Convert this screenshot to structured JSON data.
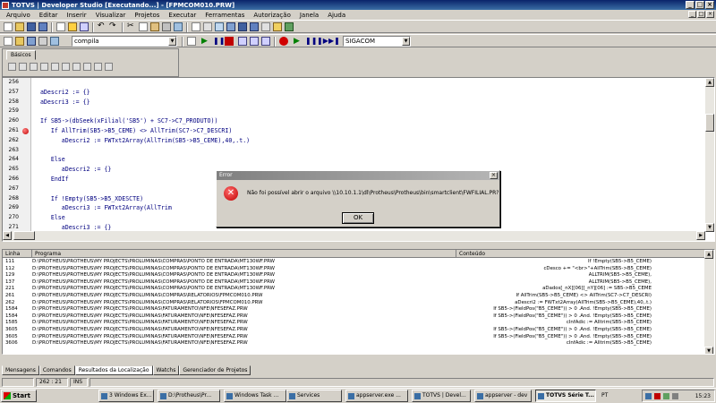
{
  "window": {
    "title": "TOTVS | Developer Studio [Executando...] - [FPMCOM010.PRW]"
  },
  "menu": [
    "Arquivo",
    "Editar",
    "Inserir",
    "Visualizar",
    "Projetos",
    "Executar",
    "Ferramentas",
    "Autorização",
    "Janela",
    "Ajuda"
  ],
  "toolbar": {
    "compile_combo": "compila",
    "environment_combo": "SIGACOM"
  },
  "palette": {
    "tab_label": "Básicos"
  },
  "editor": {
    "lines": [
      {
        "num": "256",
        "code": ""
      },
      {
        "num": "257",
        "code": "  aDescri2 := {}"
      },
      {
        "num": "258",
        "code": "  aDescri3 := {}"
      },
      {
        "num": "259",
        "code": ""
      },
      {
        "num": "260",
        "code": "  If SB5->(dbSeek(xFilial('SB5') + SC7->C7_PRODUTO))"
      },
      {
        "num": "261",
        "code": "     If AllTrim(SB5->B5_CEME) <> AllTrim(SC7->C7_DESCRI)",
        "breakpoint": true
      },
      {
        "num": "262",
        "code": "        aDescri2 := FWTxt2Array(AllTrim(SB5->B5_CEME),40,.t.)"
      },
      {
        "num": "263",
        "code": ""
      },
      {
        "num": "264",
        "code": "     Else"
      },
      {
        "num": "265",
        "code": "        aDescri2 := {}"
      },
      {
        "num": "266",
        "code": "     EndIf"
      },
      {
        "num": "267",
        "code": ""
      },
      {
        "num": "268",
        "code": "     If !Empty(SB5->B5_XDESCTE)"
      },
      {
        "num": "269",
        "code": "        aDescri3 := FWTxt2Array(AllTrim"
      },
      {
        "num": "270",
        "code": "     Else"
      },
      {
        "num": "271",
        "code": "        aDescri3 := {}"
      },
      {
        "num": "272",
        "code": "     EndIf"
      },
      {
        "num": "273",
        "code": ""
      }
    ]
  },
  "dialog": {
    "title": "Error",
    "message": "Não foi possível abrir o arquivo \\\\10.10.1.1\\dl\\Protheus\\Protheus\\bin\\smartclient\\FWFILIAL.PR?",
    "ok_label": "OK"
  },
  "results": {
    "columns": [
      "Linha",
      "Programa",
      "Conteúdo"
    ],
    "rows": [
      [
        "111",
        "D:\\PROTHEUS\\PROTHEUS\\MY PROJECTS\\PROLUMINAS\\COMPRAS\\PONTO DE ENTRADA\\MT130WF.PRW",
        "If !Empty(SB5->B5_CEME)"
      ],
      [
        "112",
        "D:\\PROTHEUS\\PROTHEUS\\MY PROJECTS\\PROLUMINAS\\COMPRAS\\PONTO DE ENTRADA\\MT130WF.PRW",
        "cDesco += \"<br>\"+AllTrim(SB5->B5_CEME)"
      ],
      [
        "129",
        "D:\\PROTHEUS\\PROTHEUS\\MY PROJECTS\\PROLUMINAS\\COMPRAS\\PONTO DE ENTRADA\\MT130WF.PRW",
        "ALLTRIM(SB5->B5_CEME),"
      ],
      [
        "137",
        "D:\\PROTHEUS\\PROTHEUS\\MY PROJECTS\\PROLUMINAS\\COMPRAS\\PONTO DE ENTRADA\\MT130WF.PRW",
        "ALLTRIM(SB5->B5_CEME),"
      ],
      [
        "221",
        "D:\\PROTHEUS\\PROTHEUS\\MY PROJECTS\\PROLUMINAS\\COMPRAS\\PONTO DE ENTRADA\\MT130WF.PRW",
        "aDados[_nX][06][_nY][06] := SB5->B5_CEME"
      ],
      [
        "261",
        "D:\\PROTHEUS\\PROTHEUS\\MY PROJECTS\\PROLUMINAS\\COMPRAS\\RELATORIOS\\FPMCOM010.PRW",
        "If AllTrim(SB5->B5_CEME) <> AllTrim(SC7->C7_DESCRI)"
      ],
      [
        "262",
        "D:\\PROTHEUS\\PROTHEUS\\MY PROJECTS\\PROLUMINAS\\COMPRAS\\RELATORIOS\\FPMCOM010.PRW",
        "aDescri2 := FWTxt2Array(AllTrim(SB5->B5_CEME),40,.t.)"
      ],
      [
        "1584",
        "D:\\PROTHEUS\\PROTHEUS\\MY PROJECTS\\PROLUMINAS\\FATURAMENTO\\NFE\\NFESEFAZ.PRW",
        "If SB5->(FieldPos(\"B5_CEME\")) > 0 .And. !Empty(SB5->B5_CEME)"
      ],
      [
        "1584",
        "D:\\PROTHEUS\\PROTHEUS\\MY PROJECTS\\PROLUMINAS\\FATURAMENTO\\NFE\\NFESEFAZ.PRW",
        "If SB5->(FieldPos(\"B5_CEME\")) > 0 .And. !Empty(SB5->B5_CEME)"
      ],
      [
        "1585",
        "D:\\PROTHEUS\\PROTHEUS\\MY PROJECTS\\PROLUMINAS\\FATURAMENTO\\NFE\\NFESEFAZ.PRW",
        "cInfAdic := Alltrim(SB5->B5_CEME)"
      ],
      [
        "3605",
        "D:\\PROTHEUS\\PROTHEUS\\MY PROJECTS\\PROLUMINAS\\FATURAMENTO\\NFE\\NFESEFAZ.PRW",
        "If SB5->(FieldPos(\"B5_CEME\")) > 0 .And. !Empty(SB5->B5_CEME)"
      ],
      [
        "3605",
        "D:\\PROTHEUS\\PROTHEUS\\MY PROJECTS\\PROLUMINAS\\FATURAMENTO\\NFE\\NFESEFAZ.PRW",
        "If SB5->(FieldPos(\"B5_CEME\")) > 0 .And. !Empty(SB5->B5_CEME)"
      ],
      [
        "3606",
        "D:\\PROTHEUS\\PROTHEUS\\MY PROJECTS\\PROLUMINAS\\FATURAMENTO\\NFE\\NFESEFAZ.PRW",
        "cInfAdic := Alltrim(SB5->B5_CEME)"
      ]
    ]
  },
  "tabs": [
    "Mensagens",
    "Comandos",
    "Resultados da Localização",
    "Watchs",
    "Gerenciador de Projetos"
  ],
  "active_tab": "Resultados da Localização",
  "status": {
    "position": "262 : 21",
    "mode": "INS"
  },
  "taskbar": {
    "start": "Start",
    "buttons": [
      "3 Windows Ex...",
      "D:\\Protheus\\Pr...",
      "Windows Task ...",
      "Services",
      "appserver.exe ...",
      "TOTVS | Devel...",
      "appserver - dev",
      "TOTVS Série T..."
    ],
    "active": "TOTVS Série T...",
    "language": "PT",
    "clock": "15:23"
  }
}
